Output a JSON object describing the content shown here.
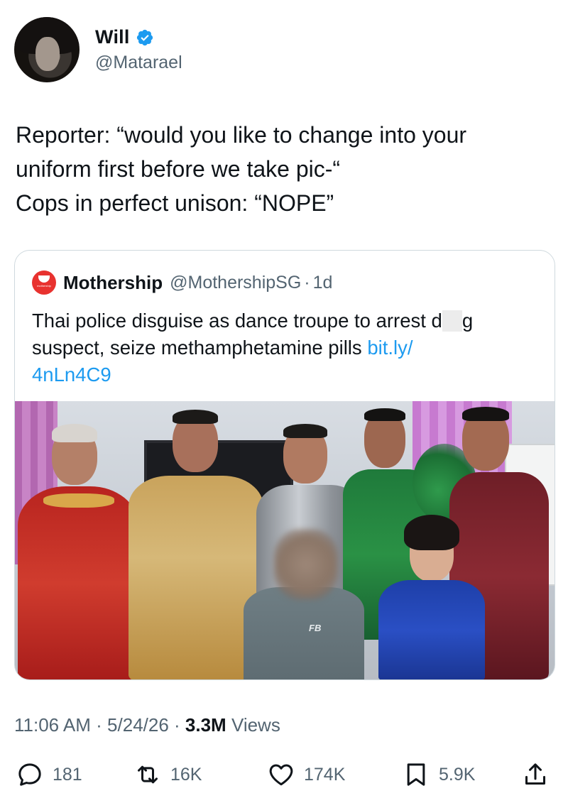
{
  "author": {
    "name": "Will",
    "handle": "@Matarael",
    "verified": true
  },
  "tweet": {
    "lines": [
      "Reporter: “would you like to change into your",
      "uniform first before we take pic-“",
      "Cops in perfect unison: “NOPE”"
    ]
  },
  "quote": {
    "name": "Mothership",
    "handle": "@MothershipSG",
    "dot": "·",
    "age": "1d",
    "logo_text": "mothership",
    "line1_before": "Thai police disguise as dance troupe to arrest d",
    "line1_after": "g",
    "line2_text": "suspect, seize methamphetamine pills ",
    "line2_link": "bit.ly/",
    "line3_link": "4nLn4C9",
    "shirt_logo": "FB"
  },
  "meta": {
    "time": "11:06 AM",
    "sep1": " · ",
    "date": "5/24/26",
    "sep2": " · ",
    "views_count": "3.3M",
    "views_label": " Views"
  },
  "actions": {
    "replies": "181",
    "reposts": "16K",
    "likes": "174K",
    "bookmarks": "5.9K"
  },
  "colors": {
    "accent": "#1d9bf0",
    "text": "#0f1419",
    "secondary": "#536471",
    "border": "#cfd9de",
    "mothership_red": "#e8322f"
  },
  "icons": [
    "verified-badge-icon",
    "reply-icon",
    "repost-icon",
    "like-icon",
    "bookmark-icon",
    "share-icon"
  ]
}
